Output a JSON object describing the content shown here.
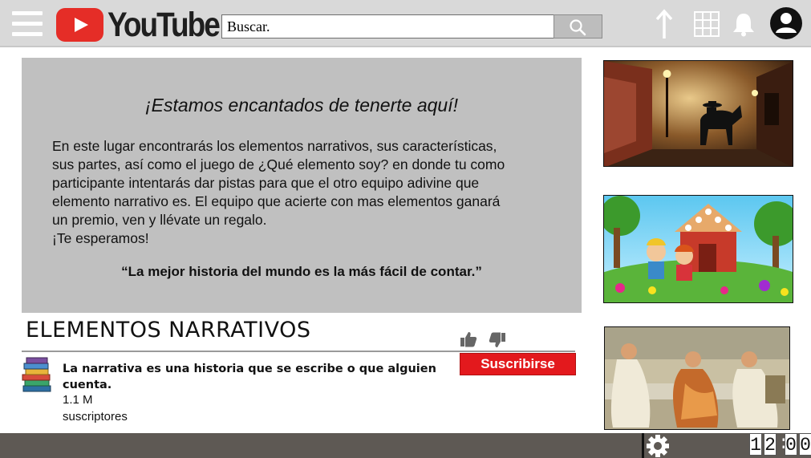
{
  "header": {
    "logo_text": "YouTube",
    "search": {
      "placeholder": "Buscar."
    },
    "icons": [
      "menu-icon",
      "search-icon",
      "upload-arrow-icon",
      "apps-grid-icon",
      "bell-icon",
      "account-icon"
    ]
  },
  "banner": {
    "title": "¡Estamos encantados de tenerte aquí!",
    "lines": [
      "En este lugar encontrarás los elementos narrativos, sus características,",
      "sus partes, así como el juego de ¿Qué elemento soy? en donde tu como",
      "participante intentarás dar pistas para que el otro equipo adivine que",
      "elemento narrativo es. El equipo que acierte con mas elementos ganará",
      "un premio, ven y llévate un regalo.",
      "¡Te esperamos!"
    ],
    "quote": "“La mejor historia del mundo es la más fácil de contar.”"
  },
  "video": {
    "title": "ELEMENTOS NARRATIVOS",
    "channel_description": "La narrativa es una historia que se escribe o que alguien cuenta.",
    "subscriber_count": "1.1 M",
    "subscriber_label": "suscriptores",
    "subscribe_label": "Suscribirse"
  },
  "bottom_bar": {
    "clock_digits": [
      "1",
      "2",
      "0",
      "0"
    ],
    "clock_separator": ":"
  },
  "colors": {
    "topbar": "#d9d9d9",
    "banner": "#c0c0c0",
    "subscribe": "#e3191d",
    "logo_red": "#e52d27",
    "bottombar": "#5e5954"
  }
}
